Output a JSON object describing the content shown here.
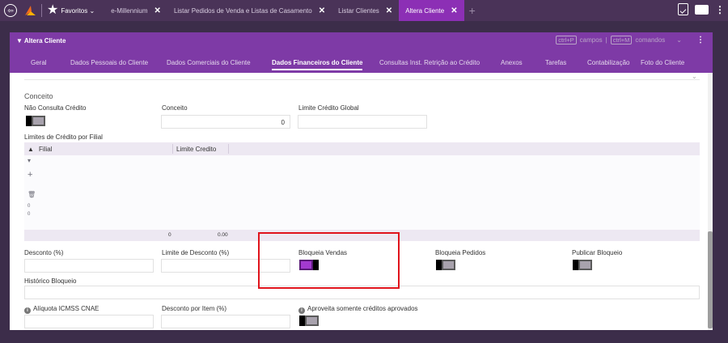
{
  "topbar": {
    "back_symbol": "⇦",
    "favorites_label": "Favoritos",
    "tabs": [
      {
        "label": "e-Millennium"
      },
      {
        "label": "Listar Pedidos de Venda e Listas de Casamento"
      },
      {
        "label": "Listar Clientes"
      },
      {
        "label": "Altera Cliente"
      }
    ],
    "close_symbol": "✕",
    "plus_symbol": "+",
    "menu_symbol": "⋮"
  },
  "window": {
    "title": "Altera Cliente",
    "kbd_campos": "ctrl+P",
    "campos_label": "campos",
    "tools_sep": "|",
    "kbd_comandos": "ctrl+M",
    "comandos_label": "comandos",
    "tools_chevron": "⌄",
    "menu_symbol": "⋮"
  },
  "subtabs": [
    {
      "label": "Geral"
    },
    {
      "label": "Dados Pessoais do Cliente"
    },
    {
      "label": "Dados Comerciais do Cliente"
    },
    {
      "label": "Dados Financeiros do Cliente"
    },
    {
      "label": "Consultas Inst. Retrição ao Crédito"
    },
    {
      "label": "Anexos"
    },
    {
      "label": "Tarefas"
    },
    {
      "label": "Contabilização"
    },
    {
      "label": "Foto do Cliente"
    }
  ],
  "form": {
    "section_title": "Conceito",
    "nao_consulta_label": "Não Consulta Crédito",
    "conceito_label": "Conceito",
    "conceito_value": "0",
    "limite_global_label": "Limite Crédito Global",
    "limites_filial_label": "Limites de Crédito por Filial",
    "grid": {
      "col_filial": "Filial",
      "col_limite": "Limite Credito",
      "sort_symbol": "▲",
      "foot_count": "0",
      "foot_total": "0.00",
      "side_icons": {
        "chevron": "▾",
        "add": "+",
        "trash": "🗑",
        "fraction_top": "0",
        "fraction_bottom": "0"
      }
    },
    "desconto_label": "Desconto (%)",
    "limite_desconto_label": "Limite de Desconto (%)",
    "bloqueia_vendas_label": "Bloqueia Vendas",
    "bloqueia_pedidos_label": "Bloqueia Pedidos",
    "publicar_bloqueio_label": "Publicar Bloqueio",
    "historico_label": "Histórico Bloqueio",
    "aliquota_label": "Alíquota ICMSS CNAE",
    "desconto_item_label": "Desconto por Item (%)",
    "aproveita_label": "Aproveita somente créditos aprovados",
    "info_symbol": "i",
    "toggles": {
      "nao_consulta": false,
      "bloqueia_vendas": true,
      "bloqueia_pedidos": false,
      "publicar_bloqueio": false,
      "aproveita": false
    }
  },
  "colors": {
    "accent": "#7e3aa6",
    "topbar": "#4a3358",
    "active_tab": "#8c2fb5",
    "highlight": "#e0141c"
  }
}
